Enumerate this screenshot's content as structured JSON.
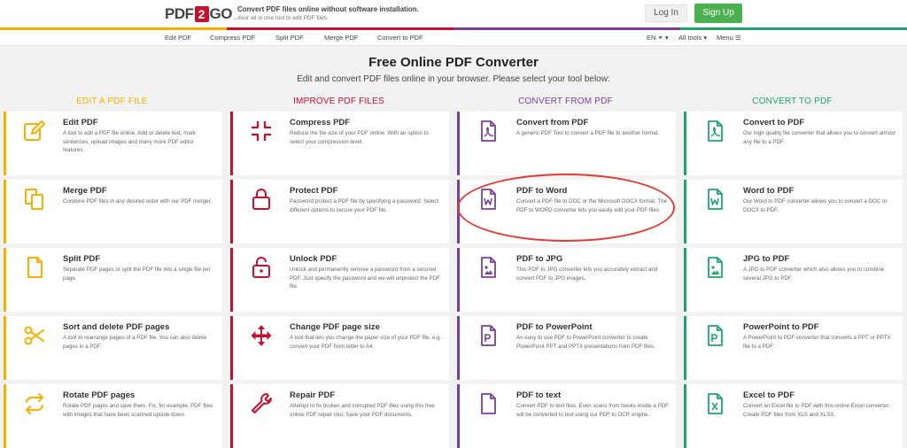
{
  "header": {
    "logo": {
      "pdf": "PDF",
      "two": "2",
      "go": "GO",
      "com": ".com"
    },
    "tagline": "Convert PDF files online without software installation.",
    "tagline_sub": "Your all in one tool to edit PDF files.",
    "login_label": "Log In",
    "signup_label": "Sign Up",
    "stripe_colors": [
      "#f6b100",
      "#c8102e",
      "#7b3f9b",
      "#1ea56b"
    ]
  },
  "nav": {
    "items": [
      "Edit PDF",
      "Compress PDF",
      "Split PDF",
      "Merge PDF",
      "Convert to PDF"
    ],
    "lang": "EN",
    "all_tools": "All tools",
    "menu": "Menu"
  },
  "main": {
    "title": "Free Online PDF Converter",
    "subtitle": "Edit and convert PDF files online in your browser. Please select your tool below:"
  },
  "columns": [
    {
      "heading": "EDIT A PDF FILE",
      "color": "#f6b100",
      "cards": [
        {
          "title": "Edit PDF",
          "icon": "edit-icon",
          "desc": "A tool to edit a PDF file online. Add or delete text, mark sentences, upload images and many more PDF editor features."
        },
        {
          "title": "Merge PDF",
          "icon": "merge-icon",
          "desc": "Combine PDF files in any desired order with our PDF merger."
        },
        {
          "title": "Split PDF",
          "icon": "split-icon",
          "desc": "Separate PDF pages or split the PDF file into a single file per page."
        },
        {
          "title": "Sort and delete PDF pages",
          "icon": "scissors-icon",
          "desc": "A tool to rearrange pages of a PDF file. You can also delete pages in a PDF."
        },
        {
          "title": "Rotate PDF pages",
          "icon": "rotate-icon",
          "desc": "Rotate PDF pages and save them. Fix, for example, PDF files with images that have been scanned upside down."
        }
      ]
    },
    {
      "heading": "IMPROVE PDF FILES",
      "color": "#c8102e",
      "cards": [
        {
          "title": "Compress PDF",
          "icon": "compress-icon",
          "desc": "Reduce the file size of your PDF online. With an option to select your compression level."
        },
        {
          "title": "Protect PDF",
          "icon": "lock-icon",
          "desc": "Password protect a PDF file by specifying a password. Select different options to secure your PDF file."
        },
        {
          "title": "Unlock PDF",
          "icon": "unlock-icon",
          "desc": "Unlock and permanently remove a password from a secured PDF. Just specify the password and we will unprotect the PDF file."
        },
        {
          "title": "Change PDF page size",
          "icon": "resize-arrows-icon",
          "desc": "A tool that lets you change the paper size of your PDF file, e.g. convert your PDF from letter to A4."
        },
        {
          "title": "Repair PDF",
          "icon": "wrench-icon",
          "desc": "Attempt to fix broken and corrupted PDF files using this free online PDF repair tool. Save your PDF documents."
        }
      ]
    },
    {
      "heading": "CONVERT FROM PDF",
      "color": "#7b3f9b",
      "cards": [
        {
          "title": "Convert from PDF",
          "icon": "pdf-file-icon",
          "desc": "A generic PDF Tool to convert a PDF file to another format."
        },
        {
          "title": "PDF to Word",
          "icon": "word-file-icon",
          "desc": "Convert a PDF file to DOC or the Microsoft DOCX format. The PDF to WORD converter lets you easily edit your PDF files."
        },
        {
          "title": "PDF to JPG",
          "icon": "image-file-icon",
          "desc": "This PDF to JPG converter lets you accurately extract and convert PDF to JPG images."
        },
        {
          "title": "PDF to PowerPoint",
          "icon": "powerpoint-file-icon",
          "desc": "An easy to use PDF to PowerPoint converter to create PowerPoint PPT and PPTX presentations from PDF files."
        },
        {
          "title": "PDF to text",
          "icon": "text-file-icon",
          "desc": "Convert PDF to text files. Even scans from books inside a PDF will be converted to text using our PDF to OCR engine."
        }
      ]
    },
    {
      "heading": "CONVERT TO PDF",
      "color": "#1ea56b",
      "cards": [
        {
          "title": "Convert to PDF",
          "icon": "pdf-file-icon",
          "desc": "Our high quality file converter that allows you to convert almost any file to a PDF."
        },
        {
          "title": "Word to PDF",
          "icon": "word-file-icon",
          "desc": "Our Word to PDF converter allows you to convert a DOC or DOCX to PDF."
        },
        {
          "title": "JPG to PDF",
          "icon": "image-file-icon",
          "desc": "A JPG to PDF converter which also allows you to combine several JPG to PDF."
        },
        {
          "title": "PowerPoint to PDF",
          "icon": "powerpoint-file-icon",
          "desc": "A PowerPoint to PDF converter that converts a PPT or PPTX file to a PDF."
        },
        {
          "title": "Excel to PDF",
          "icon": "excel-file-icon",
          "desc": "Convert an Excel file to PDF with this online Excel converter. Create PDF files from XLS and XLSX."
        }
      ]
    }
  ]
}
